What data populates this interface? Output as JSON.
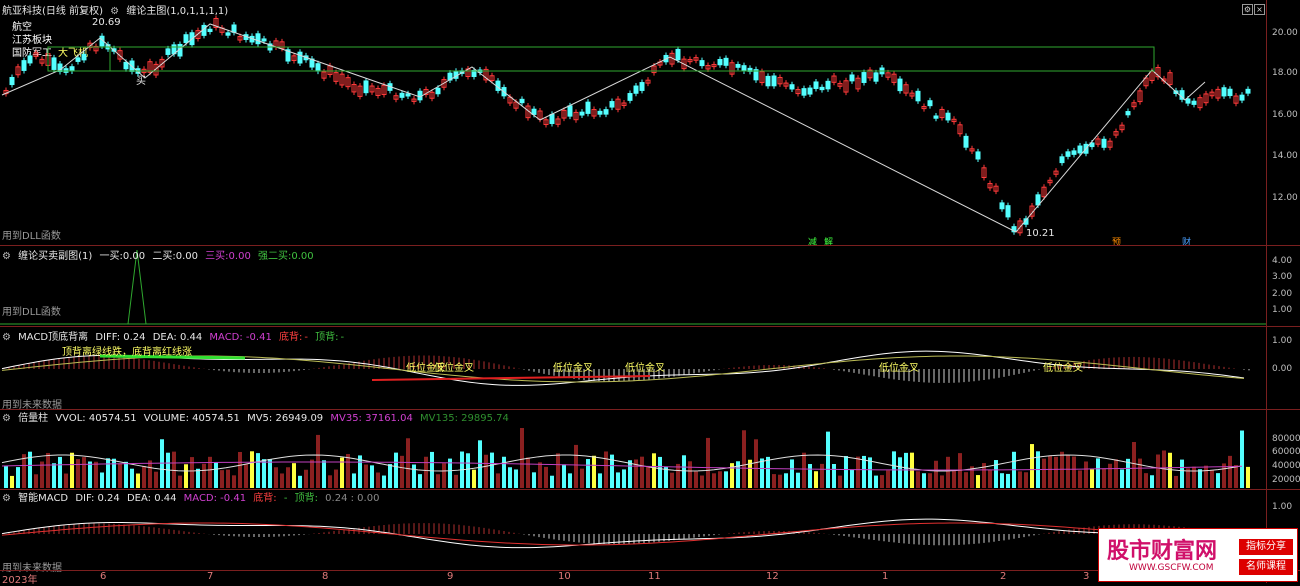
{
  "main": {
    "stock_title": "航亚科技(日线 前复权)",
    "indicator_title": "缠论主图(1,0,1,1,1,1)",
    "board_labels": [
      "航空",
      "江苏板块",
      "国防军工",
      "大飞机"
    ],
    "high_label": "20.69",
    "low_label": "10.21",
    "dll_note": "用到DLL函数",
    "buy_mark": "买",
    "event_marks": [
      "减",
      "解",
      "预",
      "财"
    ],
    "y_ticks": [
      "20.00",
      "18.00",
      "16.00",
      "14.00",
      "12.00"
    ]
  },
  "buysell": {
    "title": "缠论买卖副图(1)",
    "items": [
      {
        "label": "一买:",
        "value": "0.00"
      },
      {
        "label": "二买:",
        "value": "0.00"
      },
      {
        "label": "三买:",
        "value": "0.00"
      },
      {
        "label": "强二买:",
        "value": "0.00"
      }
    ],
    "dll_note": "用到DLL函数",
    "y_ticks": [
      "4.00",
      "3.00",
      "2.00",
      "1.00"
    ]
  },
  "macd": {
    "title": "MACD顶底背离",
    "diff": "DIFF: 0.24",
    "dea": "DEA: 0.44",
    "macd": "MACD: -0.41",
    "bottom": "底背:",
    "dash1": "-",
    "top": "顶背:",
    "dash2": "-",
    "note": "顶背离绿线跌，底背离红线涨",
    "golden_cross_labels": [
      "低位金叉",
      "低位金叉",
      "低位金叉",
      "低位金叉",
      "低位金叉",
      "低位金叉"
    ],
    "future_note": "用到未来数据",
    "y_ticks": [
      "1.00",
      "0.00"
    ]
  },
  "volume": {
    "title": "倍量柱",
    "vvol": "VVOL: 40574.51",
    "volume": "VOLUME: 40574.51",
    "mv5": "MV5: 26949.09",
    "mv35": "MV35: 37161.04",
    "mv135": "MV135: 29895.74",
    "y_ticks": [
      "80000",
      "60000",
      "40000",
      "20000"
    ]
  },
  "smart_macd": {
    "title": "智能MACD",
    "dif": "DIF: 0.24",
    "dea": "DEA: 0.44",
    "macd": "MACD: -0.41",
    "bottom": "底背:",
    "dash1": "-",
    "top": "顶背:",
    "extra": "0.24 : 0.00",
    "future_note": "用到未来数据",
    "y_ticks": [
      "1.00"
    ]
  },
  "x_axis": {
    "year": "2023年",
    "months": [
      "6",
      "7",
      "8",
      "9",
      "10",
      "11",
      "12",
      "1",
      "2",
      "3"
    ]
  },
  "watermark": {
    "title": "股市财富网",
    "url": "WWW.GSCFW.COM",
    "tag1": "指标分享",
    "tag2": "名师课程"
  },
  "colors": {
    "up": "#ff3a3a",
    "down": "#54ffff",
    "box": "#2fa82f",
    "background": "#000000"
  }
}
